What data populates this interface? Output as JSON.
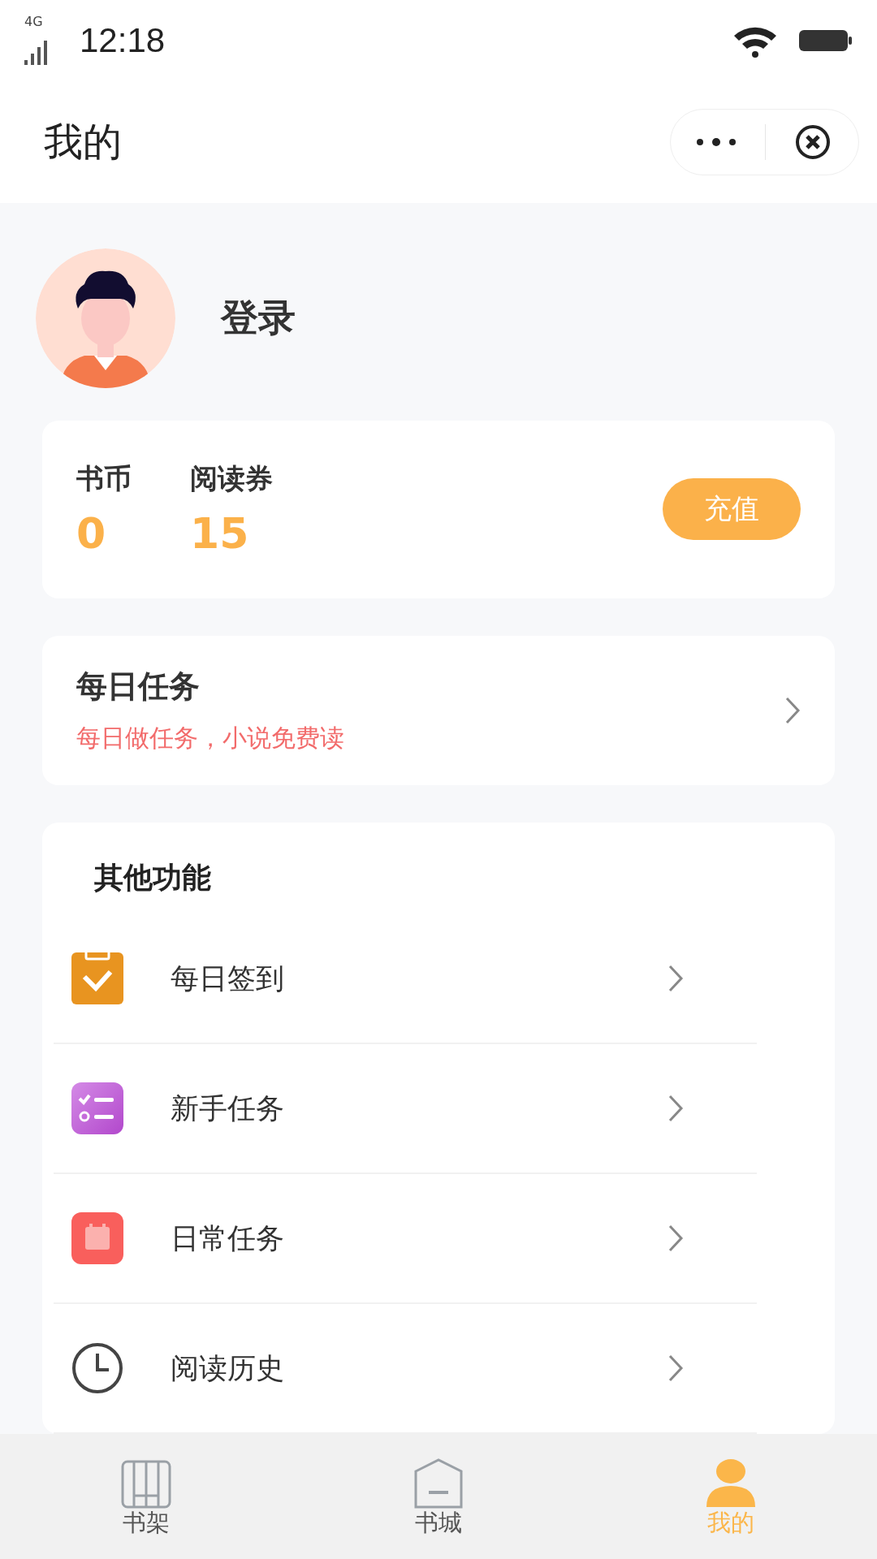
{
  "status_bar": {
    "network": "4G",
    "time": "12:18"
  },
  "header": {
    "title": "我的"
  },
  "profile": {
    "login": "登录"
  },
  "wallet": {
    "items": [
      {
        "label": "书币",
        "value": "0"
      },
      {
        "label": "阅读券",
        "value": "15"
      }
    ],
    "button": "充值"
  },
  "daily_task": {
    "title": "每日任务",
    "subtitle": "每日做任务，小说免费读"
  },
  "other_functions": {
    "title": "其他功能",
    "items": [
      {
        "label": "每日签到",
        "kind": "checkin"
      },
      {
        "label": "新手任务",
        "kind": "checklist"
      },
      {
        "label": "日常任务",
        "kind": "calendar"
      },
      {
        "label": "阅读历史",
        "kind": "history"
      }
    ]
  },
  "tab_bar": [
    {
      "label": "书架",
      "kind": "shelf",
      "selected": false
    },
    {
      "label": "书城",
      "kind": "store",
      "selected": false
    },
    {
      "label": "我的",
      "kind": "me",
      "selected": true
    }
  ]
}
